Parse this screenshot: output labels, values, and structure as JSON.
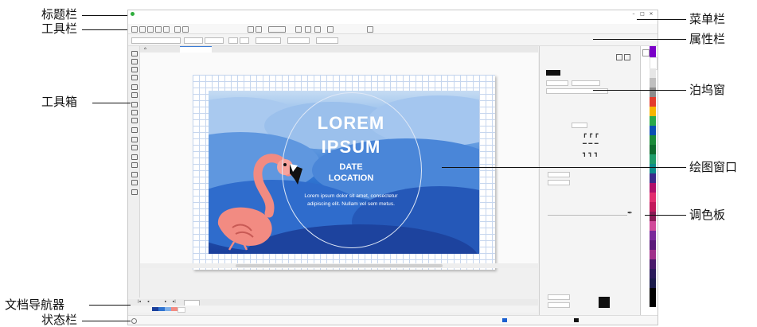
{
  "callouts": {
    "title_bar": "标题栏",
    "toolbar": "工具栏",
    "toolbox": "工具箱",
    "doc_navigator": "文档导航器",
    "status_bar": "状态栏",
    "menu_bar": "菜单栏",
    "property_bar": "属性栏",
    "docker": "泊坞窗",
    "drawing_window": "绘图窗口",
    "color_palette": "调色板"
  },
  "artwork": {
    "line1": "LOREM",
    "line2": "IPSUM",
    "date": "DATE",
    "location": "LOCATION",
    "body": "Lorem ipsum dolor sit amet, consectetur adipiscing elit. Nullam vel sem metus."
  },
  "colors": {
    "accent": "#3a7bd5",
    "art_top": "#c6dcf3",
    "art_bottom": "#1a3f9c",
    "flamingo": "#f28b82"
  },
  "icons": [
    "app-logo-icon",
    "minimize-icon",
    "maximize-icon",
    "close-icon",
    "hand-icon"
  ]
}
